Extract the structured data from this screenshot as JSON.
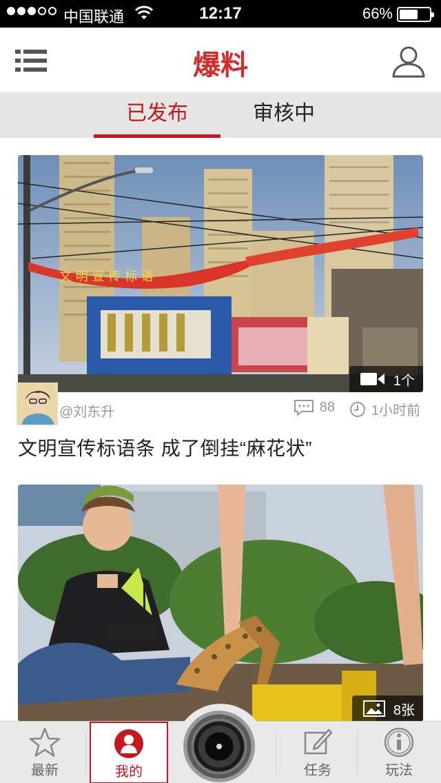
{
  "status_bar": {
    "carrier": "中国联通",
    "time": "12:17",
    "battery": "66%",
    "battery_level": 0.66,
    "signal_bars": 2
  },
  "nav": {
    "title": "爆料",
    "menu_icon": "list-menu-icon",
    "user_icon": "user-profile-icon"
  },
  "tabs": [
    {
      "label": "已发布",
      "active": true
    },
    {
      "label": "审核中",
      "active": false
    }
  ],
  "feed": [
    {
      "author": "@刘东升",
      "comments": "88",
      "time": "1小时前",
      "title": "文明宣传标语条 成了倒挂“麻花状”",
      "media_type": "video",
      "media_count": "1个"
    },
    {
      "media_type": "photo",
      "media_count": "8张"
    }
  ],
  "tab_bar": {
    "items": [
      {
        "label": "最新",
        "icon": "star-icon",
        "active": false
      },
      {
        "label": "我的",
        "icon": "person-icon",
        "active": true
      },
      {
        "label": "任务",
        "icon": "edit-task-icon",
        "active": false
      },
      {
        "label": "玩法",
        "icon": "info-icon",
        "active": false
      }
    ],
    "camera_icon": "camera-lens-icon"
  },
  "colors": {
    "accent": "#c8161d",
    "title_red": "#d42a2a",
    "tab_strip_bg": "#e6e6e6",
    "tab_bar_bg": "#e9e9e9"
  }
}
